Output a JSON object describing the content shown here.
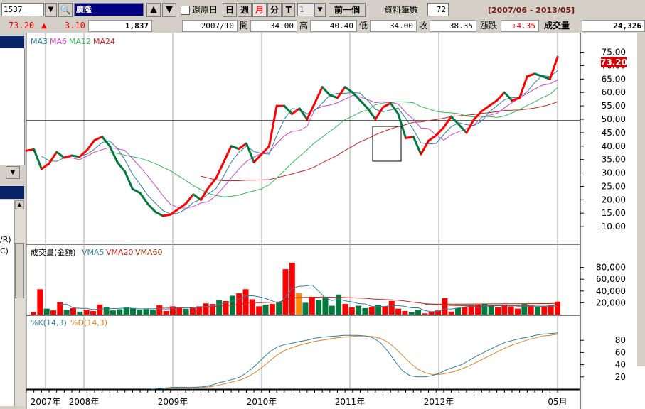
{
  "toolbar": {
    "stock_code": "1537",
    "stock_name": "廣隆",
    "restore_label": "還原日",
    "period_day": "日",
    "period_week": "週",
    "period_month": "月",
    "period_minute": "分",
    "period_tick": "T",
    "multiplier_value": "1",
    "prev_button": "前一個",
    "data_count_label": "資料筆數",
    "data_count_value": "72",
    "date_range": "[2007/06 - 2013/05]"
  },
  "info_bar": {
    "last_price": "73.20",
    "change": "3.10",
    "total_volume": "1,837",
    "period": "2007/10",
    "open_label": "開",
    "open_value": "34.00",
    "high_label": "高",
    "high_value": "40.40",
    "low_label": "低",
    "low_value": "34.00",
    "close_label": "收",
    "close_value": "38.35",
    "change_label": "漲跌",
    "change_value": "+4.35",
    "volume_label": "成交量",
    "volume_value": "24,326"
  },
  "left_panel": {
    "text_1": "/R)",
    "text_2": "C)"
  },
  "colors": {
    "up": "#ff0000",
    "down": "#007a3d",
    "ma3": "#2f7f9f",
    "ma6": "#cc44cc",
    "ma12": "#33bb55",
    "ma24": "#cc2222",
    "k_line": "#2f7f9f",
    "d_line": "#e08020",
    "highlight_bar": "#ff8c00"
  },
  "chart_data": [
    {
      "type": "line",
      "title": "",
      "legend": [
        "MA3",
        "MA6",
        "MA12",
        "MA24"
      ],
      "price_tag": "73.20",
      "ylim": [
        5,
        77
      ],
      "yticks": [
        "75.00",
        "70.00",
        "65.00",
        "60.00",
        "55.00",
        "50.00",
        "45.00",
        "40.00",
        "35.00",
        "30.00",
        "25.00",
        "20.00",
        "15.00",
        "10.00"
      ],
      "reference_line": 49.5,
      "x_labels": [
        "2007年",
        "2008年",
        "2009年",
        "2010年",
        "2011年",
        "2012年",
        "05月"
      ],
      "close": [
        38.3,
        38.8,
        31.5,
        33.5,
        37.8,
        35.7,
        36.5,
        36,
        38.5,
        42.2,
        43.5,
        40,
        34,
        30.5,
        24,
        22.5,
        18.5,
        15.5,
        14,
        14.5,
        16.5,
        18.5,
        22,
        20,
        24.5,
        28,
        34,
        40,
        39,
        41,
        34,
        37,
        40,
        55,
        55,
        52,
        54,
        50,
        56,
        62,
        59,
        58,
        62,
        60,
        57,
        54,
        50,
        54.5,
        56,
        52,
        43,
        43.5,
        37,
        42,
        44,
        47,
        51,
        48,
        45,
        50,
        53,
        55,
        57,
        60,
        57,
        58,
        66,
        67,
        66,
        65,
        73.2
      ],
      "up": [
        1,
        1,
        0,
        1,
        1,
        0,
        1,
        0,
        1,
        1,
        1,
        0,
        0,
        0,
        0,
        0,
        0,
        0,
        0,
        1,
        1,
        1,
        1,
        0,
        1,
        1,
        1,
        1,
        0,
        1,
        0,
        1,
        1,
        1,
        1,
        0,
        1,
        0,
        1,
        1,
        0,
        0,
        1,
        0,
        0,
        0,
        0,
        1,
        1,
        0,
        0,
        1,
        0,
        1,
        1,
        1,
        1,
        0,
        0,
        1,
        1,
        1,
        1,
        1,
        0,
        1,
        1,
        1,
        0,
        0,
        1
      ],
      "ma3": [
        null,
        null,
        36.2,
        34.6,
        34.3,
        35.7,
        36.7,
        36.1,
        37,
        38.9,
        41.4,
        41.9,
        39.2,
        34.8,
        29.5,
        25.7,
        21.7,
        18.8,
        16,
        14.7,
        15,
        16.5,
        19,
        20.2,
        22.2,
        24.2,
        28.8,
        34,
        37.7,
        40,
        38,
        37.3,
        37,
        44,
        50,
        54,
        53.7,
        52,
        53.3,
        56,
        59,
        59.7,
        59.7,
        60,
        59.7,
        57,
        53.7,
        52.8,
        53.5,
        54.2,
        50.3,
        46.2,
        41.2,
        40.8,
        41,
        44.3,
        47.3,
        48.7,
        48,
        47.7,
        49.3,
        52.7,
        55,
        57.3,
        58,
        58.3,
        60.3,
        63.7,
        66.3,
        66,
        68.1
      ],
      "ma6": [
        null,
        null,
        null,
        null,
        null,
        35.8,
        35.6,
        34.9,
        36.3,
        37.8,
        38.7,
        39.5,
        39.1,
        38.4,
        35.3,
        32.2,
        28.9,
        25.3,
        21.5,
        18.3,
        17.1,
        16.8,
        17.5,
        18.8,
        19.3,
        21.6,
        24.7,
        28.1,
        31.4,
        34.3,
        35.9,
        37.3,
        37.6,
        41,
        43.8,
        45.5,
        45.8,
        47.4,
        53.6,
        54.8,
        55.3,
        56.2,
        57.5,
        58.9,
        58.3,
        57.3,
        56.2,
        56.5,
        56.3,
        55.7,
        52.5,
        50,
        46.8,
        46.5,
        44.2,
        42.2,
        44.2,
        45.4,
        46.5,
        47.9,
        50.7,
        51.5,
        52.2,
        54.3,
        56.2,
        57.9,
        59.6,
        61.3,
        62.7,
        63.2,
        64.7
      ],
      "ma12": [
        null,
        null,
        null,
        null,
        null,
        null,
        null,
        null,
        null,
        null,
        null,
        37.6,
        37.3,
        36.6,
        36,
        35.5,
        34.6,
        33.5,
        32.1,
        30.8,
        29,
        27.2,
        25.3,
        23.8,
        22.4,
        21.6,
        21.1,
        21.3,
        21.7,
        22.6,
        23.3,
        24.1,
        25.6,
        28.1,
        30.9,
        33.7,
        36.2,
        38.7,
        41.3,
        43.3,
        45.5,
        47.6,
        49.9,
        51.2,
        52.6,
        53.5,
        55.4,
        56.1,
        56.3,
        56.5,
        56.4,
        56.2,
        54.7,
        53.9,
        53,
        52.6,
        52.4,
        52.1,
        51.2,
        50.9,
        51.1,
        51,
        50.7,
        51.2,
        52.4,
        53.6,
        55.2,
        56.5,
        58.1,
        59.3,
        61.8
      ],
      "ma24": [
        null,
        null,
        null,
        null,
        null,
        null,
        null,
        null,
        null,
        null,
        null,
        null,
        null,
        null,
        null,
        null,
        null,
        null,
        null,
        null,
        null,
        null,
        null,
        28.8,
        28.1,
        27.4,
        27.1,
        27.1,
        27.1,
        27.3,
        27.3,
        27.4,
        27.5,
        28.2,
        28.9,
        29.6,
        30.4,
        31.1,
        32.3,
        33.8,
        35.2,
        36.6,
        38.4,
        40,
        41.6,
        42.8,
        44.2,
        45.4,
        46.4,
        47.3,
        48,
        48.9,
        49,
        49.5,
        49.9,
        50.4,
        51,
        51.3,
        51.5,
        51.8,
        52.2,
        52.5,
        52.8,
        53.3,
        53.4,
        53.5,
        53.8,
        54.2,
        54.8,
        55.5,
        56.5
      ]
    },
    {
      "type": "bar",
      "title": "成交量(金額)",
      "legend": [
        "VMA5",
        "VMA20",
        "VMA60"
      ],
      "ylim": [
        0,
        100000
      ],
      "yticks": [
        "80,000",
        "60,000",
        "40,000",
        "20,000"
      ],
      "volume": [
        4000,
        43000,
        10000,
        7000,
        21000,
        8000,
        11000,
        5000,
        8000,
        6000,
        17000,
        13000,
        7000,
        9000,
        13000,
        11000,
        8000,
        9000,
        8000,
        16000,
        6000,
        14000,
        13000,
        10000,
        12000,
        14000,
        19000,
        18000,
        24000,
        23000,
        32000,
        36000,
        43000,
        26000,
        14000,
        17000,
        18000,
        21000,
        77000,
        88000,
        36000,
        20000,
        30000,
        25000,
        29000,
        15000,
        34000,
        18000,
        12000,
        15000,
        11000,
        13000,
        16000,
        14000,
        23000,
        10000,
        6000,
        4000,
        8000,
        2000,
        5000,
        7000,
        28000,
        5000,
        11000,
        13000,
        16000,
        17000,
        18000,
        15000,
        12000,
        17000,
        14000,
        10000,
        18000,
        15000,
        13000,
        14000,
        16000,
        22000
      ],
      "vol_up": [
        1,
        1,
        0,
        1,
        1,
        0,
        1,
        0,
        1,
        1,
        1,
        0,
        0,
        0,
        0,
        0,
        0,
        0,
        0,
        1,
        1,
        1,
        1,
        0,
        1,
        1,
        1,
        1,
        0,
        1,
        0,
        1,
        1,
        1,
        1,
        0,
        1,
        0,
        1,
        1,
        0,
        0,
        1,
        0,
        0,
        0,
        0,
        1,
        1,
        0,
        0,
        1,
        0,
        1,
        1,
        1,
        1,
        0,
        0,
        1,
        1,
        1,
        1,
        1,
        0,
        1,
        1,
        1,
        0,
        0,
        1,
        1,
        1,
        1,
        0,
        1,
        0,
        1,
        1,
        1
      ],
      "highlight_index": 40,
      "vma5": [
        null,
        null,
        null,
        null,
        17000,
        18000,
        11400,
        10600,
        10600,
        8400,
        9400,
        9800,
        10200,
        10400,
        11600,
        10600,
        9600,
        10000,
        9800,
        10400,
        9400,
        10600,
        11400,
        11800,
        11000,
        13400,
        13600,
        14600,
        17400,
        19600,
        23200,
        26600,
        31600,
        32000,
        30200,
        27200,
        23200,
        19200,
        29400,
        44200,
        48000,
        48400,
        50200,
        39800,
        28000,
        23800,
        26600,
        23200,
        21600,
        18800,
        18000,
        13800,
        13400,
        13800,
        15400,
        15200,
        13800,
        11400,
        11600,
        6800,
        5000,
        5200,
        10000,
        9400,
        11200,
        12800,
        14600,
        12400,
        15000,
        15800,
        15600,
        15800,
        15600,
        14200,
        14200,
        14400,
        14000,
        14000,
        14200,
        14400
      ],
      "vma20": [
        null,
        null,
        null,
        null,
        null,
        null,
        null,
        null,
        null,
        null,
        null,
        null,
        null,
        null,
        null,
        null,
        null,
        null,
        null,
        12000,
        12100,
        11900,
        12000,
        12100,
        11900,
        12300,
        12700,
        13300,
        14300,
        15100,
        16200,
        17400,
        19100,
        20000,
        20200,
        20500,
        21000,
        21600,
        24600,
        28100,
        28900,
        29200,
        29400,
        29600,
        29800,
        29400,
        29300,
        28900,
        28600,
        28000,
        27700,
        26600,
        25900,
        25400,
        25000,
        24200,
        23000,
        21200,
        20000,
        18500,
        17700,
        16700,
        16300,
        15600,
        15300,
        15000,
        14800,
        14600,
        14600,
        14600,
        14900,
        15100,
        15200,
        15400,
        15600,
        15800,
        15900,
        15900,
        16000,
        16300
      ],
      "vma60": [
        null,
        null,
        null,
        null,
        null,
        null,
        null,
        null,
        null,
        null,
        null,
        null,
        null,
        null,
        null,
        null,
        null,
        null,
        null,
        null,
        null,
        null,
        null,
        null,
        null,
        null,
        null,
        null,
        null,
        null,
        null,
        null,
        null,
        null,
        null,
        null,
        null,
        null,
        null,
        null,
        null,
        null,
        null,
        null,
        null,
        null,
        null,
        null,
        null,
        null,
        null,
        null,
        null,
        null,
        null,
        null,
        null,
        null,
        null,
        17600,
        17700,
        17600,
        17900,
        17800,
        17700,
        17800,
        17900,
        18000,
        18100,
        18200,
        18200,
        18300,
        18300,
        18300,
        18400,
        18600,
        18600,
        18700,
        18800,
        18900
      ]
    },
    {
      "type": "line",
      "title": "",
      "legend": [
        "%K(14,3)",
        "%D(14,3)"
      ],
      "ylim": [
        0,
        100
      ],
      "yticks": [
        "80",
        "60",
        "40",
        "20"
      ],
      "k": [
        null,
        null,
        null,
        null,
        null,
        null,
        null,
        null,
        null,
        null,
        null,
        null,
        null,
        null,
        null,
        null,
        null,
        0,
        1,
        2,
        3,
        3,
        2,
        3,
        4,
        6,
        10,
        13,
        16,
        20,
        28,
        38,
        50,
        61,
        69,
        73,
        75,
        78,
        80,
        83,
        85,
        86,
        87,
        88,
        88,
        88,
        87,
        84,
        76,
        62,
        45,
        30,
        22,
        20,
        20,
        22,
        26,
        32,
        36,
        40,
        47,
        54,
        60,
        66,
        72,
        77,
        80,
        83,
        85,
        88,
        90,
        91,
        92
      ],
      "d": [
        null,
        null,
        null,
        null,
        null,
        null,
        null,
        null,
        null,
        null,
        null,
        null,
        null,
        null,
        null,
        null,
        null,
        null,
        null,
        1,
        2,
        3,
        3,
        3,
        3,
        4,
        6,
        9,
        12,
        15,
        20,
        27,
        36,
        46,
        56,
        63,
        68,
        72,
        75,
        78,
        80,
        82,
        84,
        85,
        86,
        87,
        87,
        86,
        83,
        77,
        67,
        55,
        43,
        33,
        27,
        24,
        24,
        26,
        29,
        33,
        38,
        44,
        50,
        56,
        62,
        68,
        73,
        77,
        81,
        84,
        87,
        88,
        90
      ]
    }
  ]
}
